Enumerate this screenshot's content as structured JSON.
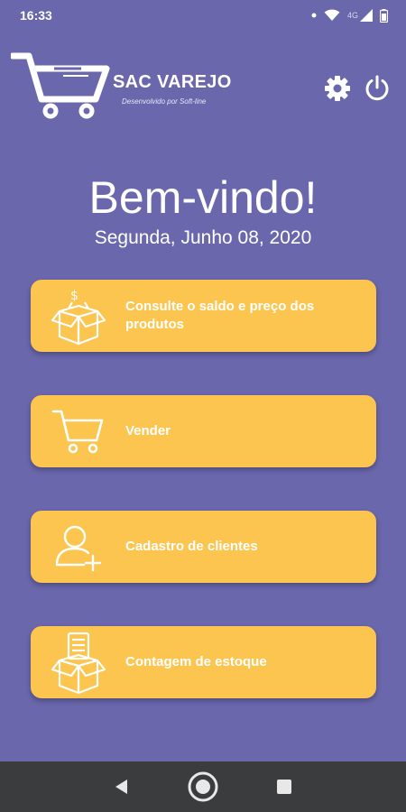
{
  "status_bar": {
    "time": "16:33",
    "network": "4G",
    "icons": [
      "dot-icon",
      "wifi-icon",
      "signal-icon",
      "battery-icon"
    ]
  },
  "header": {
    "brand_name": "SAC VAREJO",
    "brand_subtitle": "Desenvolvido por Soft-line",
    "icons": [
      "cart-logo-icon",
      "gear-icon",
      "power-icon"
    ]
  },
  "welcome": {
    "title": "Bem-vindo!",
    "date": "Segunda, Junho 08, 2020"
  },
  "menu": {
    "items": [
      {
        "label": "Consulte o saldo e preço dos produtos",
        "icon": "money-box-icon"
      },
      {
        "label": "Vender",
        "icon": "cart-icon"
      },
      {
        "label": "Cadastro de clientes",
        "icon": "add-user-icon"
      },
      {
        "label": "Contagem de estoque",
        "icon": "inventory-box-icon"
      }
    ]
  },
  "colors": {
    "background": "#6a67ad",
    "button": "#fcc54f",
    "text": "#ffffff",
    "nav_bar": "#3a3c3e"
  },
  "nav_bar": {
    "icons": [
      "back-icon",
      "home-icon",
      "recents-icon"
    ]
  }
}
